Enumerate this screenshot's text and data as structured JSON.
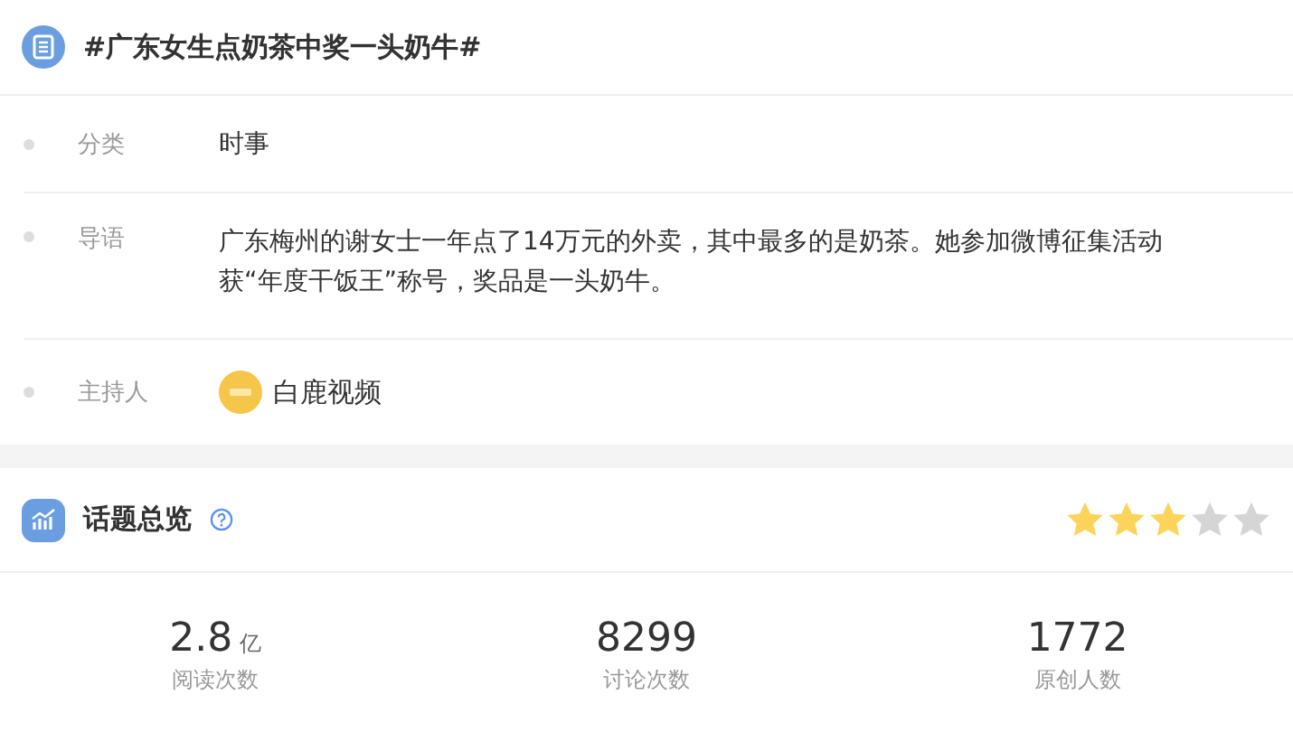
{
  "topic": {
    "title": "#广东女生点奶茶中奖一头奶牛#"
  },
  "details": [
    {
      "kind": "text",
      "label": "分类",
      "value": "时事"
    },
    {
      "kind": "text",
      "label": "导语",
      "value": "广东梅州的谢女士一年点了14万元的外卖，其中最多的是奶茶。她参加微博征集活动获“年度干饭王”称号，奖品是一头奶牛。"
    },
    {
      "kind": "host",
      "label": "主持人",
      "value": "白鹿视频"
    }
  ],
  "overview": {
    "title": "话题总览",
    "stars": 3,
    "stats": [
      {
        "value": "2.8",
        "unit": "亿",
        "label": "阅读次数"
      },
      {
        "value": "8299",
        "label": "讨论次数"
      },
      {
        "value": "1772",
        "label": "原创人数"
      }
    ]
  }
}
